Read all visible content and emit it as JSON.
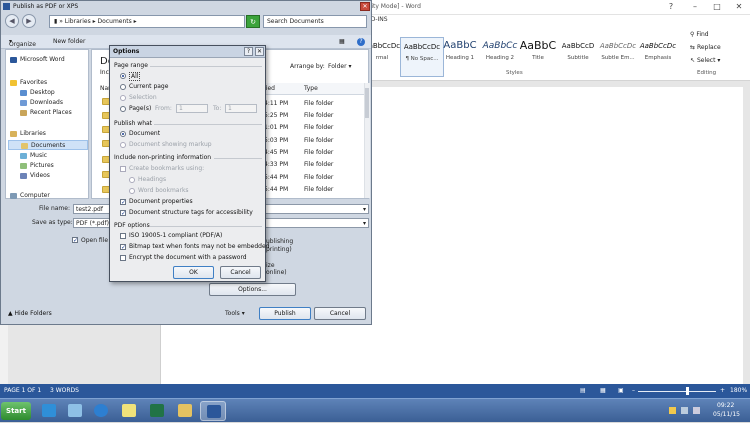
{
  "word": {
    "title_suffix": "ility Mode] - Word",
    "addins_tab": "ADD-INS",
    "styles": [
      {
        "preview": "AaBbCcDc",
        "name": "rmal"
      },
      {
        "preview": "AaBbCcDc",
        "name": "¶ No Spac..."
      },
      {
        "preview": "AaBbC",
        "name": "Heading 1"
      },
      {
        "preview": "AaBbCc",
        "name": "Heading 2"
      },
      {
        "preview": "AaBbC",
        "name": "Title"
      },
      {
        "preview": "AaBbCcD",
        "name": "Subtitle"
      },
      {
        "preview": "AaBbCcDc",
        "name": "Subtle Em..."
      },
      {
        "preview": "AaBbCcDc",
        "name": "Emphasis"
      }
    ],
    "styles_group": "Styles",
    "editing": {
      "find": "Find",
      "replace": "Replace",
      "select": "Select",
      "group": "Editing"
    },
    "status": {
      "page": "PAGE 1 OF 1",
      "words": "3 WORDS",
      "zoom": "180%"
    }
  },
  "taskbar": {
    "start": "Start",
    "time": "09:22",
    "date": "05/11/15",
    "colors": {
      "active": "#ffffff"
    }
  },
  "publish": {
    "title": "Publish as PDF or XPS",
    "breadcrumb": [
      "Libraries",
      "Documents"
    ],
    "search_placeholder": "Search Documents",
    "toolbar": {
      "organize": "Organize",
      "new_folder": "New folder"
    },
    "nav": [
      {
        "label": "Microsoft Word"
      },
      {
        "label": "Favorites"
      },
      {
        "label": "Desktop"
      },
      {
        "label": "Downloads"
      },
      {
        "label": "Recent Places"
      },
      {
        "label": "Libraries"
      },
      {
        "label": "Documents"
      },
      {
        "label": "Music"
      },
      {
        "label": "Pictures"
      },
      {
        "label": "Videos"
      },
      {
        "label": "Computer"
      }
    ],
    "folder_heading": "Do",
    "folder_sub": "Inclu",
    "arrange_by": "Arrange by:",
    "arrange_value": "Folder",
    "columns": {
      "name": "Nam",
      "modified": "ified",
      "type": "Type"
    },
    "rows": [
      {
        "time": "4:11 PM",
        "type": "File folder"
      },
      {
        "time": "5:25 PM",
        "type": "File folder"
      },
      {
        "time": "1:01 PM",
        "type": "File folder"
      },
      {
        "time": "5:03 PM",
        "type": "File folder"
      },
      {
        "time": "4:45 PM",
        "type": "File folder"
      },
      {
        "time": "4:33 PM",
        "type": "File folder"
      },
      {
        "time": "5:44 PM",
        "type": "File folder"
      },
      {
        "time": "5:44 PM",
        "type": "File folder"
      }
    ],
    "file_name_label": "File name:",
    "file_name_value": "test2.pdf",
    "save_type_label": "Save as type:",
    "save_type_value": "PDF (*.pdf)",
    "open_file_label": "Open file a",
    "opt_text1": "ublishing",
    "opt_text2": "printing)",
    "opt_text3": "ize",
    "opt_text4": "online)",
    "options_button": "Options...",
    "hide_folders": "Hide Folders",
    "tools": "Tools",
    "publish_button": "Publish",
    "cancel_button": "Cancel"
  },
  "options": {
    "title": "Options",
    "page_range": "Page range",
    "all": "All",
    "current_page": "Current page",
    "selection": "Selection",
    "pages": "Page(s)",
    "from": "From:",
    "from_value": "1",
    "to": "To:",
    "to_value": "1",
    "publish_what": "Publish what",
    "document": "Document",
    "doc_markup": "Document showing markup",
    "non_printing": "Include non-printing information",
    "create_bookmarks": "Create bookmarks using:",
    "headings": "Headings",
    "word_bookmarks": "Word bookmarks",
    "doc_properties": "Document properties",
    "doc_structure": "Document structure tags for accessibility",
    "pdf_options": "PDF options",
    "iso": "ISO 19005-1 compliant (PDF/A)",
    "bitmap": "Bitmap text when fonts may not be embedded",
    "encrypt": "Encrypt the document with a password",
    "ok": "OK",
    "cancel": "Cancel"
  }
}
